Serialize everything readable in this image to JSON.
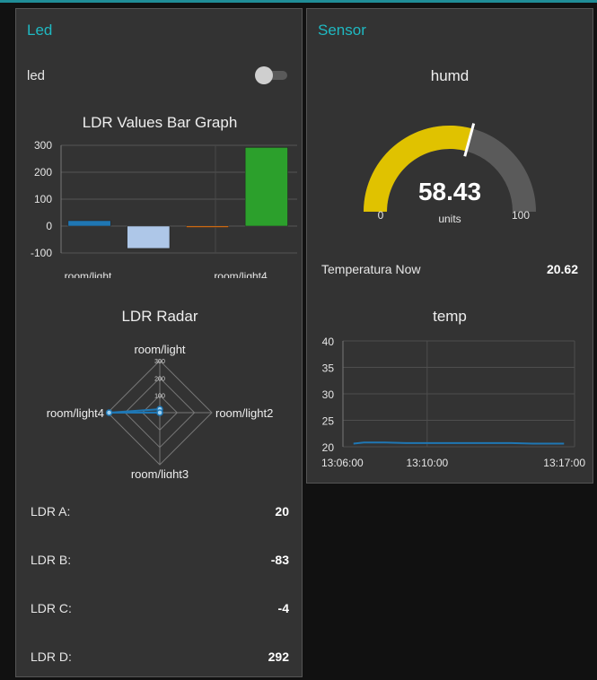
{
  "led_group": {
    "title": "Led",
    "switch_label": "led",
    "switch_state": false,
    "bar_chart": {
      "title": "LDR Values Bar Graph"
    },
    "radar": {
      "title": "LDR Radar"
    },
    "values": [
      {
        "label": "LDR A:",
        "value": "20"
      },
      {
        "label": "LDR B:",
        "value": "-83"
      },
      {
        "label": "LDR C:",
        "value": "-4"
      },
      {
        "label": "LDR D:",
        "value": "292"
      }
    ]
  },
  "sensor_group": {
    "title": "Sensor",
    "gauge": {
      "title": "humd",
      "value_text": "58.43",
      "value": 58.43,
      "min": 0,
      "max": 100,
      "min_label": "0",
      "max_label": "100",
      "units": "units",
      "fill_color": "#e0c200",
      "track_color": "#5a5a5a"
    },
    "temperature_now": {
      "label": "Temperatura Now",
      "value": "20.62"
    },
    "temp_chart": {
      "title": "temp"
    }
  },
  "chart_data": [
    {
      "type": "bar",
      "title": "LDR Values Bar Graph",
      "categories": [
        "room/light",
        "room/light2",
        "room/light3",
        "room/light4"
      ],
      "x_tick_labels": [
        "room/light",
        "room/light4"
      ],
      "values": [
        20,
        -83,
        -4,
        292
      ],
      "colors": [
        "#1f77b4",
        "#aec7e8",
        "#ff7f0e",
        "#2ca02c"
      ],
      "ylim": [
        -100,
        300
      ],
      "y_ticks": [
        "300",
        "200",
        "100",
        "0",
        "-100"
      ],
      "grid": true
    },
    {
      "type": "radar",
      "title": "LDR Radar",
      "categories": [
        "room/light",
        "room/light2",
        "room/light3",
        "room/light4"
      ],
      "values": [
        20,
        -83,
        -4,
        292
      ],
      "scale_labels": [
        "300",
        "200",
        "100"
      ],
      "color": "#1f77b4"
    },
    {
      "type": "line",
      "title": "temp",
      "x_tick_labels": [
        "13:06:00",
        "13:10:00",
        "13:17:00"
      ],
      "y_ticks": [
        "40",
        "35",
        "30",
        "25",
        "20"
      ],
      "ylim": [
        20,
        40
      ],
      "x": [
        "13:06:30",
        "13:07:00",
        "13:08:00",
        "13:09:00",
        "13:10:00",
        "13:11:00",
        "13:12:00",
        "13:13:00",
        "13:14:00",
        "13:15:00",
        "13:16:30"
      ],
      "y": [
        20.6,
        20.8,
        20.8,
        20.7,
        20.7,
        20.7,
        20.7,
        20.7,
        20.7,
        20.6,
        20.6
      ],
      "color": "#1f77b4",
      "grid": true
    }
  ]
}
